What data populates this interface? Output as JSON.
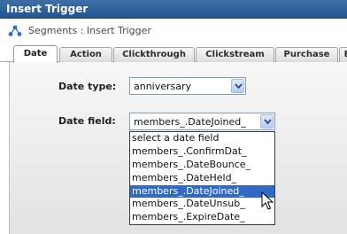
{
  "window": {
    "title": "Insert Trigger"
  },
  "breadcrumb": {
    "icon": "segments-icon",
    "text": "Segments : Insert Trigger"
  },
  "tabs": [
    {
      "label": "Date",
      "active": true
    },
    {
      "label": "Action",
      "active": false
    },
    {
      "label": "Clickthrough",
      "active": false
    },
    {
      "label": "Clickstream",
      "active": false
    },
    {
      "label": "Purchase",
      "active": false
    },
    {
      "label": "E",
      "active": false
    }
  ],
  "form": {
    "date_type": {
      "label": "Date type:",
      "value": "anniversary"
    },
    "date_field": {
      "label": "Date field:",
      "value": "members_.DateJoined_",
      "options": [
        "select a date field",
        "members_.ConfirmDat_",
        "members_.DateBounce_",
        "members_.DateHeld_",
        "members_.DateJoined_",
        "members_.DateUnsub_",
        "members_.ExpireDate_"
      ],
      "selected_index": 4
    }
  },
  "colors": {
    "titlebar": "#2f5f9a",
    "selection": "#3169c6",
    "accent_icon": "#2a6fc9"
  }
}
